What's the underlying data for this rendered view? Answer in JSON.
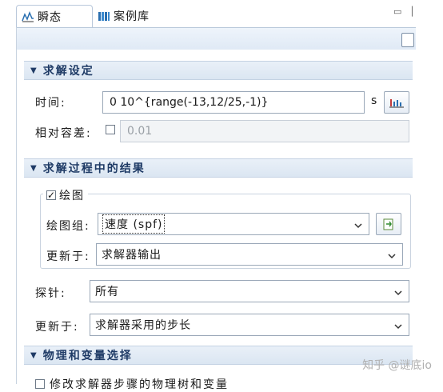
{
  "tabs": [
    {
      "label": "瞬态",
      "icon": "chart-icon",
      "active": true
    },
    {
      "label": "案例库",
      "icon": "library-icon",
      "active": false
    }
  ],
  "sections": {
    "solver_settings": {
      "title": "求解设定",
      "time_label": "时间:",
      "time_value": "0 10^{range(-13,12/25,-1)}",
      "time_unit": "s",
      "rel_tol_label": "相对容差:",
      "rel_tol_value": "0.01"
    },
    "results_during_solve": {
      "title": "求解过程中的结果",
      "plot_checkbox_label": "绘图",
      "plot_group_label": "绘图组:",
      "plot_group_value": "速度 (spf)",
      "update_label_1": "更新于:",
      "update_value_1": "求解器输出",
      "probe_label": "探针:",
      "probe_value": "所有",
      "update_label_2": "更新于:",
      "update_value_2": "求解器采用的步长"
    },
    "physics_variables": {
      "title": "物理和变量选择",
      "modify_checkbox_label": "修改求解器步骤的物理树和变量"
    }
  },
  "watermark": "知乎 @谜底io",
  "colors": {
    "section_title": "#1f3b66",
    "section_bg": "#dbe6f2"
  }
}
